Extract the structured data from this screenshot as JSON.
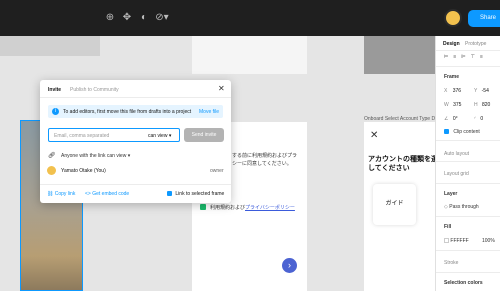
{
  "toolbar": {
    "share_label": "Share"
  },
  "panel": {
    "tabs": [
      "Design",
      "Prototype",
      "Inspect"
    ],
    "frame_title": "Frame",
    "fields": {
      "x": "376",
      "y": "-54",
      "w": "375",
      "h": "820",
      "rotation": "0°",
      "radius": "0"
    },
    "clip_content": "Clip content",
    "auto_layout": "Auto layout",
    "layout_grid": "Layout grid",
    "layer": "Layer",
    "pass_through": "Pass through",
    "fill": "Fill",
    "fill_hex": "FFFFFF",
    "fill_opacity": "100%",
    "stroke": "Stroke",
    "selection_colors": "Selection colors"
  },
  "modal": {
    "tab_invite": "Invite",
    "tab_publish": "Publish to Community",
    "info_text": "To add editors, first move this file from drafts into a project",
    "move_file": "Move file",
    "email_placeholder": "Email, comma separated",
    "can_view": "can view",
    "send_invite": "Send invite",
    "link_access": "Anyone with the link can view",
    "member_name": "Yamato Otake (You)",
    "member_role": "owner",
    "copy_link": "Copy link",
    "get_embed": "Get embed code",
    "link_selected": "Link to selected frame"
  },
  "canvas": {
    "frame_label": "Onboard Select Account Type Di",
    "jp_title_1": "アカウントの種類を選",
    "jp_title_2": "してください",
    "guide": "ガイド",
    "jp_text_1": "する前に利用規約およびプラ",
    "jp_text_2": "シーに同意してください。",
    "jp_text_3": "利用規約および",
    "jp_link": "プライバシーポリシー",
    "jp_text_4": "に同意します"
  },
  "colors": {
    "accent": "#0d99ff",
    "toolbar_bg": "#1f1f1f",
    "info_bg": "#e5f4ff"
  }
}
